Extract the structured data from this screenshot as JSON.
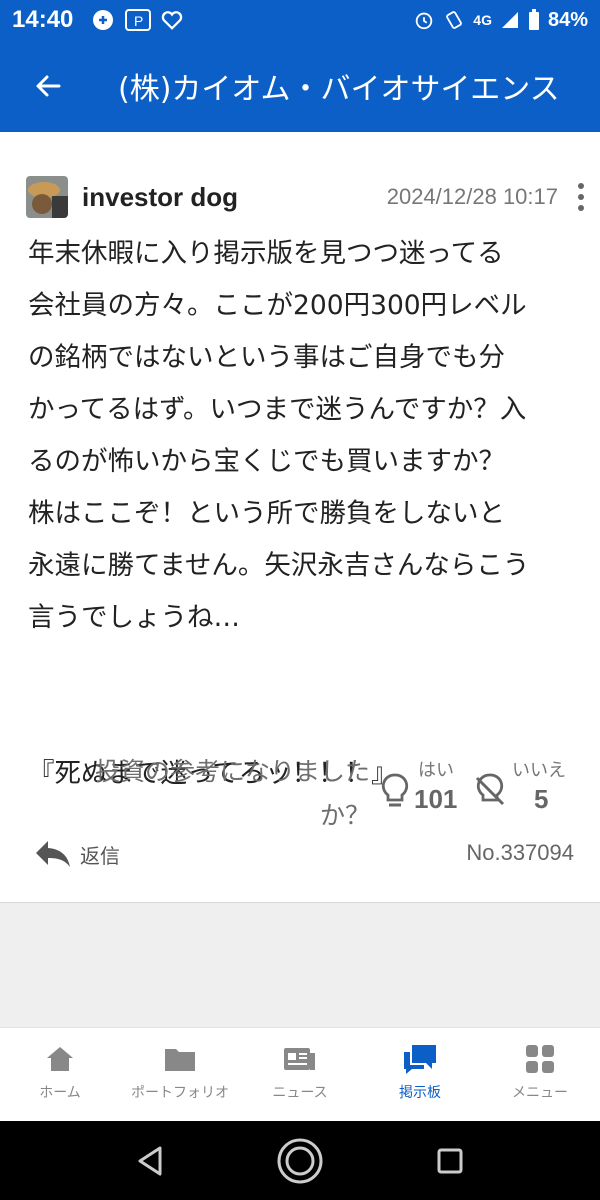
{
  "status_bar": {
    "time": "14:40",
    "network": "4G",
    "battery": "84%"
  },
  "app_bar": {
    "title": "(株)カイオム・バイオサイエンス"
  },
  "post": {
    "author": "investor dog",
    "date": "2024/12/28 10:17",
    "body": "年末休暇に入り掲示版を見つつ迷ってる\n会社員の方々。ここが200円300円レベル\nの銘柄ではないという事はご自身でも分\nかってるはず。いつまで迷うんですか？入\nるのが怖いから宝くじでも買いますか？\n株はここぞ！という所で勝負をしないと\n永遠に勝てません。矢沢永吉さんならこう\n言うでしょうね…\n\n\n『死ぬまで迷ってろッ！！！』",
    "helpful_question": "投資の参考になりました\nか？",
    "yes_label": "はい",
    "yes_count": "101",
    "no_label": "いいえ",
    "no_count": "5",
    "reply_label": "返信",
    "post_number": "No.337094"
  },
  "tabs": [
    {
      "label": "ホーム",
      "icon": "home-icon"
    },
    {
      "label": "ポートフォリオ",
      "icon": "folder-icon"
    },
    {
      "label": "ニュース",
      "icon": "news-icon"
    },
    {
      "label": "掲示板",
      "icon": "chat-icon",
      "active": true
    },
    {
      "label": "メニュー",
      "icon": "grid-icon"
    }
  ],
  "colors": {
    "brand": "#0b5fc7",
    "inactive_tab": "#888888"
  }
}
